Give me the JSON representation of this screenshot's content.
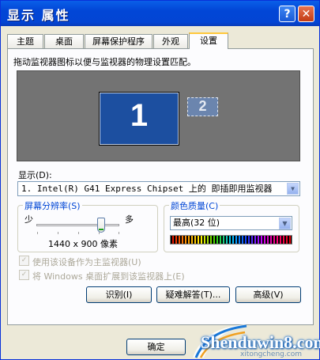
{
  "window": {
    "title": "显示  属性",
    "help_label": "?",
    "close_label": "✕"
  },
  "tabs": [
    {
      "label": "主题"
    },
    {
      "label": "桌面"
    },
    {
      "label": "屏幕保护程序"
    },
    {
      "label": "外观"
    },
    {
      "label": "设置"
    }
  ],
  "settings": {
    "instruction": "拖动监视器图标以便与监视器的物理设置匹配。",
    "monitor1_label": "1",
    "monitor2_label": "2",
    "display_label": "显示(D):",
    "display_value": "1. Intel(R) G41 Express Chipset 上的 即插即用监视器",
    "resolution": {
      "title": "屏幕分辨率(S)",
      "less_label": "少",
      "more_label": "多",
      "value": "1440 x 900 像素",
      "slider_position": 0.8
    },
    "color_quality": {
      "title": "颜色质量(C)",
      "value": "最高(32 位)"
    },
    "checkboxes": [
      {
        "label": "使用该设备作为主监视器(U)",
        "checked": true,
        "disabled": true
      },
      {
        "label": "将 Windows 桌面扩展到该监视器上(E)",
        "checked": true,
        "disabled": true
      }
    ],
    "buttons": {
      "identify": "识别(I)",
      "troubleshoot": "疑难解答(T)...",
      "advanced": "高级(V)"
    }
  },
  "footer": {
    "ok": "确定"
  },
  "watermark": {
    "text": "Shenduwin8.com",
    "subtext": "xitongcheng.com"
  },
  "colors": {
    "titlebar": "#0a5fe8",
    "monitor_active": "#1c4fa0",
    "monitor_area": "#737373",
    "group_title": "#0046d5"
  }
}
